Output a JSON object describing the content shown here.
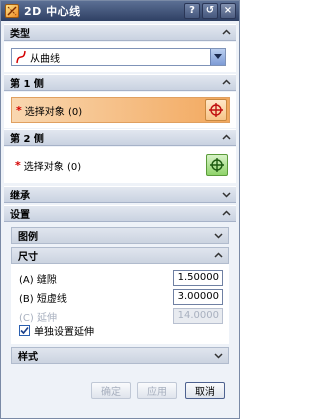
{
  "title_bar": {
    "title": "2D 中心线",
    "buttons": {
      "help": "?",
      "reset": "↺",
      "close": "×"
    }
  },
  "sections": {
    "type": {
      "label": "类型",
      "dropdown_value": "从曲线"
    },
    "side1": {
      "label": "第 1 侧",
      "select_label": "选择对象 (0)"
    },
    "side2": {
      "label": "第 2 侧",
      "select_label": "选择对象 (0)"
    },
    "inherit": {
      "label": "继承"
    },
    "settings": {
      "label": "设置",
      "style_group": {
        "label": "图例"
      },
      "size_group": {
        "label": "尺寸",
        "fields": [
          {
            "label": "(A) 缝隙",
            "value": "1.50000",
            "disabled": false
          },
          {
            "label": "(B) 短虚线",
            "value": "3.00000",
            "disabled": false
          },
          {
            "label": "(C) 延伸",
            "value": "14.0000",
            "disabled": true
          }
        ],
        "checkbox_label": "单独设置延伸",
        "checkbox_checked": true
      },
      "appearance_group": {
        "label": "样式"
      }
    }
  },
  "footer": {
    "ok_label": "确定",
    "apply_label": "应用",
    "cancel_label": "取消"
  },
  "colors": {
    "title_bar": "#3a4c72",
    "active_select": "#f2a85e",
    "required_star": "#d40000"
  }
}
